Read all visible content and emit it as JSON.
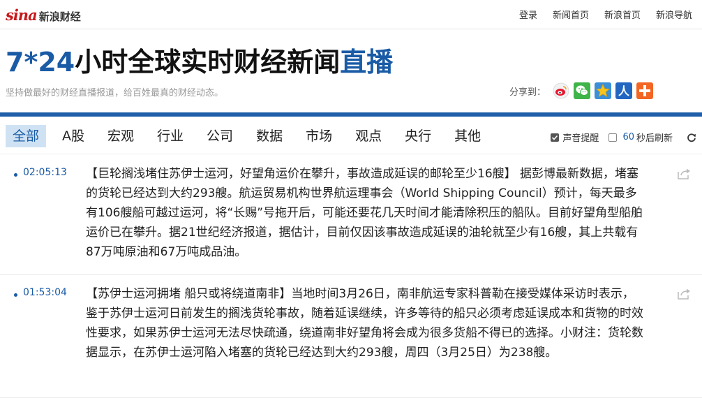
{
  "header": {
    "logo_sina": "sina",
    "logo_text": "新浪财经",
    "links": [
      "登录",
      "新闻首页",
      "新浪首页",
      "新浪导航"
    ]
  },
  "title": {
    "prefix": "7*24",
    "middle": "小时全球实时财经新闻",
    "suffix": "直播"
  },
  "subtitle": "坚持做最好的财经直播报道，给百姓最真的财经动态。",
  "share": {
    "label": "分享到：",
    "targets": [
      "weibo-icon",
      "wechat-icon",
      "qzone-icon",
      "renren-icon",
      "more-icon"
    ]
  },
  "nav": {
    "tabs": [
      "全部",
      "A股",
      "宏观",
      "行业",
      "公司",
      "数据",
      "市场",
      "观点",
      "央行",
      "其他"
    ],
    "active_tab": "全部",
    "sound_label": "声音提醒",
    "sound_checked": true,
    "refresh_seconds": "60",
    "refresh_label": "秒后刷新",
    "refresh_checked": false
  },
  "feed": [
    {
      "time": "02:05:13",
      "text": "【巨轮搁浅堵住苏伊士运河，好望角运价在攀升，事故造成延误的邮轮至少16艘】 据彭博最新数据，堵塞的货轮已经达到大约293艘。航运贸易机构世界航运理事会（World Shipping Council）预计，每天最多有106艘船可越过运河，将“长赐”号拖开后，可能还要花几天时间才能清除积压的船队。目前好望角型船舶运价已在攀升。据21世纪经济报道，据估计，目前仅因该事故造成延误的油轮就至少有16艘，其上共载有87万吨原油和67万吨成品油。"
    },
    {
      "time": "01:53:04",
      "text": "【苏伊士运河拥堵 船只或将绕道南非】当地时间3月26日，南非航运专家科普勒在接受媒体采访时表示，鉴于苏伊士运河日前发生的搁浅货轮事故，随着延误继续，许多等待的船只必须考虑延误成本和货物的时效性要求，如果苏伊士运河无法尽快疏通，绕道南非好望角将会成为很多货船不得已的选择。小财注：货轮数据显示，在苏伊士运河陷入堵塞的货轮已经达到大约293艘，周四（3月25日）为238艘。"
    }
  ],
  "colors": {
    "brand_red": "#c6181b",
    "accent_blue": "#1a5ba6",
    "rule_blue": "#1f5ea8",
    "active_tab_bg": "#cfe2f3"
  }
}
